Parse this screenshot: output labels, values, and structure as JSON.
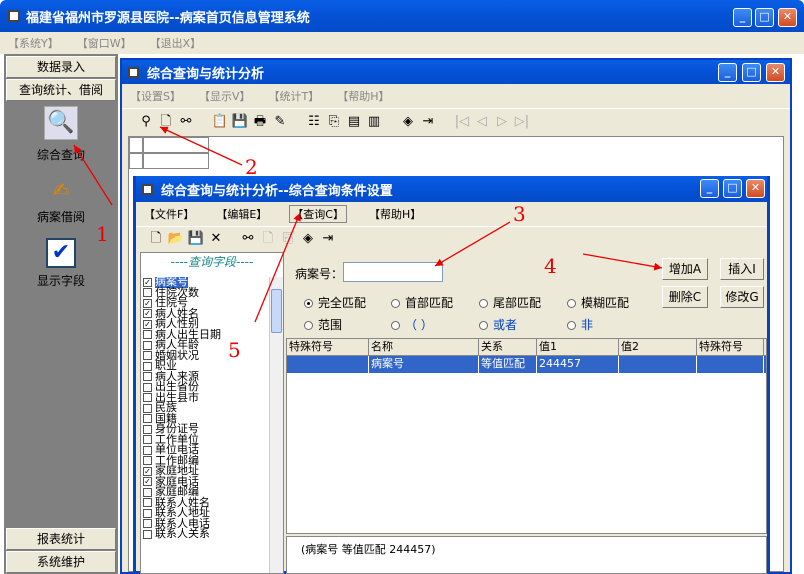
{
  "main_window": {
    "title": "福建省福州市罗源县医院--病案首页信息管理系统",
    "menu": [
      "【系统Y】",
      "【窗口W】",
      "【退出X】"
    ]
  },
  "left_panel": {
    "buttons": [
      "数据录入",
      "查询统计、借阅"
    ],
    "items": [
      {
        "icon": "magnifier-icon",
        "label": "综合查询"
      },
      {
        "icon": "hand-book-icon",
        "label": "病案借阅"
      },
      {
        "icon": "checkmark-icon",
        "label": "显示字段"
      }
    ],
    "bottom_buttons": [
      "报表统计",
      "系统维护"
    ]
  },
  "mdi_window": {
    "title": "综合查询与统计分析",
    "menu": [
      "【设置S】",
      "【显示V】",
      "【统计T】",
      "【帮助H】"
    ]
  },
  "dialog": {
    "title": "综合查询与统计分析--综合查询条件设置",
    "menu": [
      "【文件F】",
      "【编辑E】",
      "【查询C】",
      "【帮助H】"
    ],
    "fields_header": "----查询字段----",
    "fields": [
      {
        "label": "病案号",
        "checked": true,
        "selected": true
      },
      {
        "label": "住院次数",
        "checked": false
      },
      {
        "label": "住院号",
        "checked": true
      },
      {
        "label": "病人姓名",
        "checked": true
      },
      {
        "label": "病人性别",
        "checked": true
      },
      {
        "label": "病人出生日期",
        "checked": false
      },
      {
        "label": "病人年龄",
        "checked": false
      },
      {
        "label": "婚姻状况",
        "checked": false
      },
      {
        "label": "职业",
        "checked": false
      },
      {
        "label": "病人来源",
        "checked": false
      },
      {
        "label": "出生省份",
        "checked": false
      },
      {
        "label": "出生县市",
        "checked": false
      },
      {
        "label": "民族",
        "checked": false
      },
      {
        "label": "国籍",
        "checked": false
      },
      {
        "label": "身份证号",
        "checked": false
      },
      {
        "label": "工作单位",
        "checked": false
      },
      {
        "label": "单位电话",
        "checked": false
      },
      {
        "label": "工作邮编",
        "checked": false
      },
      {
        "label": "家庭地址",
        "checked": true
      },
      {
        "label": "家庭电话",
        "checked": true
      },
      {
        "label": "家庭邮编",
        "checked": false
      },
      {
        "label": "联系人姓名",
        "checked": false
      },
      {
        "label": "联系人地址",
        "checked": false
      },
      {
        "label": "联系人电话",
        "checked": false
      },
      {
        "label": "联系人关系",
        "checked": false
      }
    ],
    "bingan_label": "病案号：",
    "bingan_value": "",
    "buttons": {
      "add": "增加A",
      "insert": "插入I",
      "delete": "删除C",
      "modify": "修改G"
    },
    "radios": [
      {
        "label": "完全匹配",
        "on": true
      },
      {
        "label": "首部匹配",
        "on": false
      },
      {
        "label": "尾部匹配",
        "on": false
      },
      {
        "label": "模糊匹配",
        "on": false
      },
      {
        "label": "范围",
        "on": false
      },
      {
        "label": "（  ）",
        "on": false
      },
      {
        "label": "或者",
        "on": false
      },
      {
        "label": "非",
        "on": false
      }
    ],
    "table_headers": [
      "特殊符号",
      "名称",
      "关系",
      "值1",
      "值2",
      "特殊符号"
    ],
    "table_row": [
      "",
      "病案号",
      "等值匹配",
      "244457",
      "",
      ""
    ],
    "summary": "(病案号 等值匹配 244457)"
  },
  "annotations": [
    "1",
    "2",
    "3",
    "4",
    "5"
  ]
}
